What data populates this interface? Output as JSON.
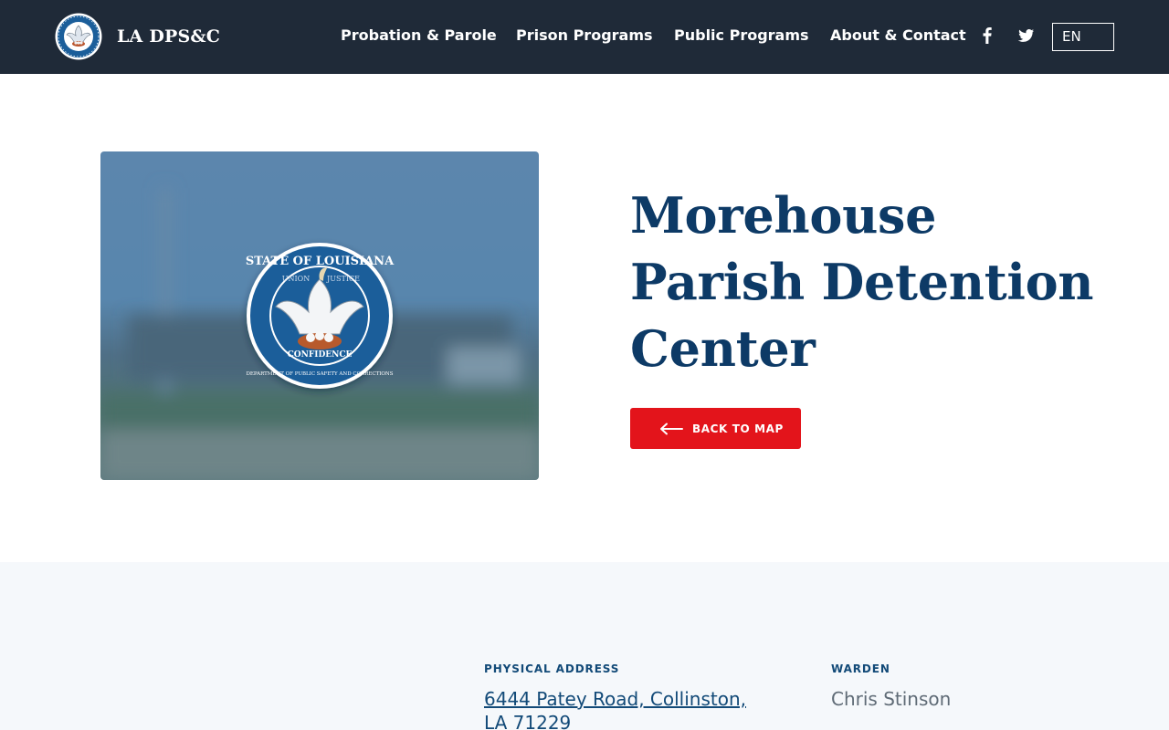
{
  "header": {
    "brand": "LA DPS&C",
    "nav": [
      {
        "label": "Probation & Parole"
      },
      {
        "label": "Prison Programs"
      },
      {
        "label": "Public Programs"
      },
      {
        "label": "About & Contact"
      }
    ],
    "language": "EN"
  },
  "seal": {
    "top_text": "STATE OF LOUISIANA",
    "motto_left": "UNION",
    "motto_right": "JUSTICE",
    "motto_bottom": "CONFIDENCE",
    "outer_text": "DEPARTMENT OF PUBLIC SAFETY AND CORRECTIONS"
  },
  "hero": {
    "title": "Morehouse Parish Detention Center",
    "back_button": "BACK TO MAP"
  },
  "details": {
    "address_label": "PHYSICAL ADDRESS",
    "address": "6444 Patey Road, Collinston, LA 71229",
    "warden_label": "WARDEN",
    "warden": "Chris Stinson"
  },
  "colors": {
    "header_bg": "#1f2a38",
    "title": "#0d3a66",
    "button": "#e3141b",
    "details_bg": "#f5f8fb",
    "label": "#124a78"
  }
}
